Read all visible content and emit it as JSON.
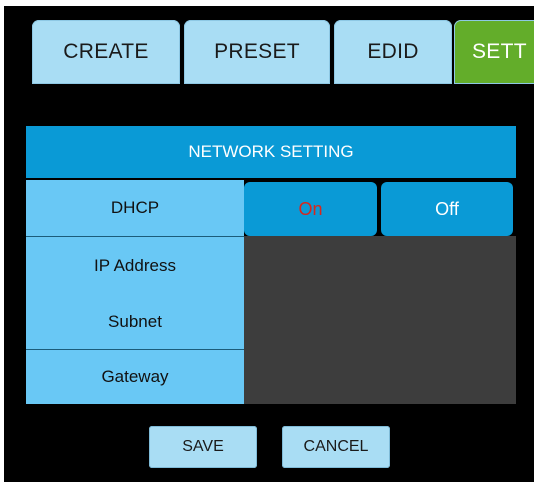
{
  "tabs": [
    {
      "label": "CREATE"
    },
    {
      "label": "PRESET"
    },
    {
      "label": "EDID"
    },
    {
      "label": "SETT"
    }
  ],
  "network": {
    "header": "NETWORK SETTING",
    "dhcp_label": "DHCP",
    "dhcp_on": "On",
    "dhcp_off": "Off",
    "ip_label": "IP Address",
    "subnet_label": "Subnet",
    "gateway_label": "Gateway"
  },
  "actions": {
    "save": "SAVE",
    "cancel": "CANCEL"
  },
  "colors": {
    "tab_bg": "#a9ddf4",
    "active_tab": "#63ad2a",
    "header_bg": "#0a9ad6",
    "label_bg": "#69c8f5",
    "on_text": "#d9261c",
    "off_text": "#ffffff"
  }
}
